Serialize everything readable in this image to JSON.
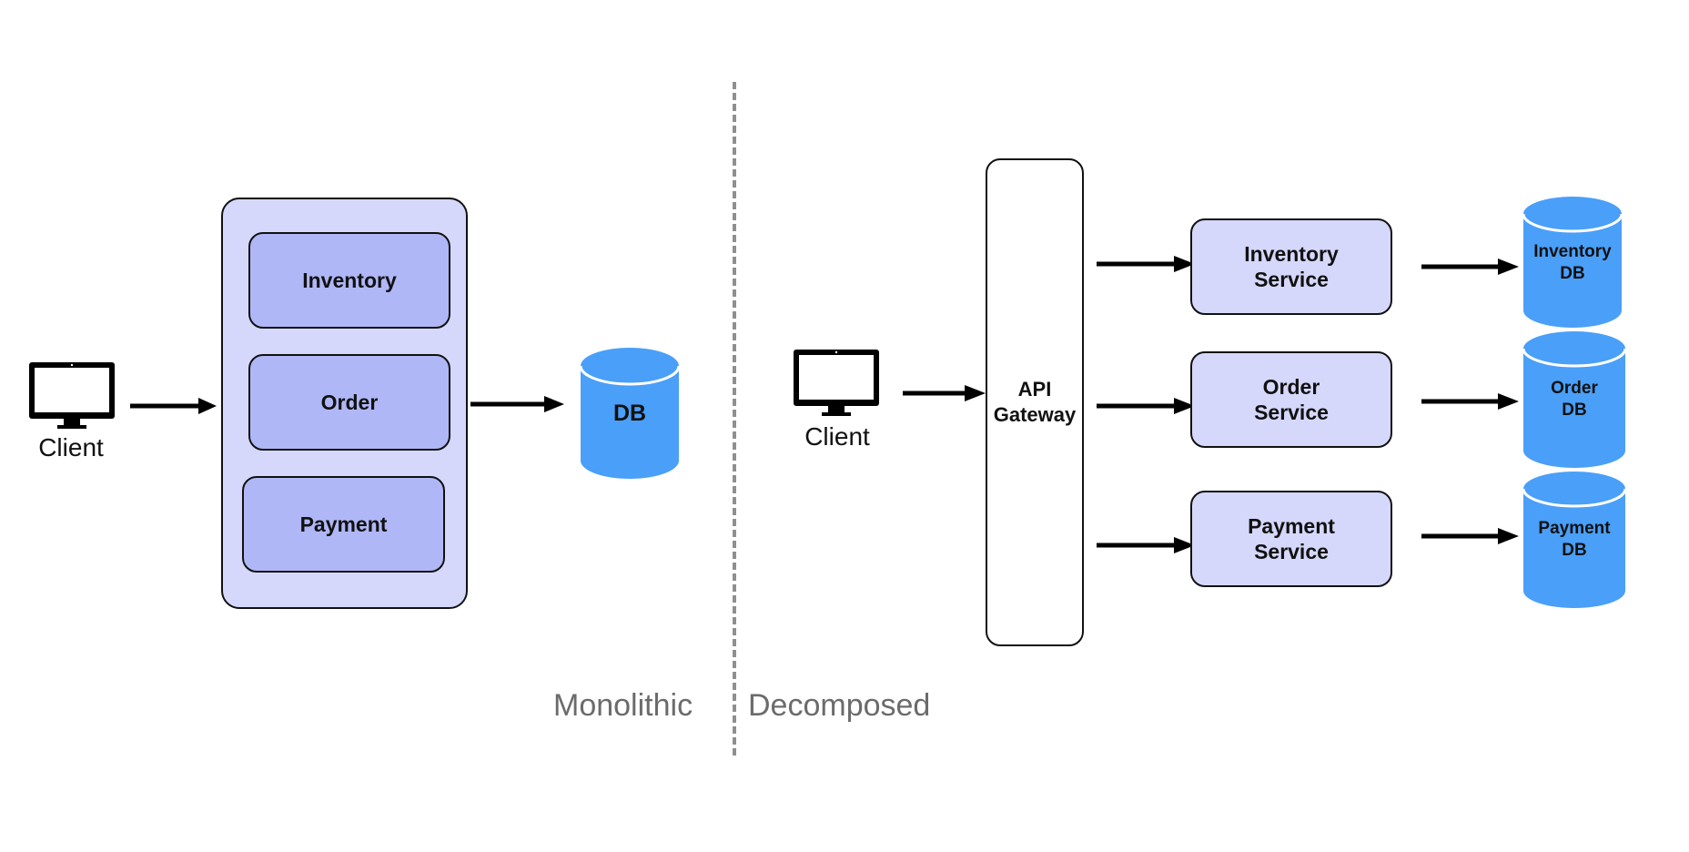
{
  "sections": {
    "monolithic": "Monolithic",
    "decomposed": "Decomposed"
  },
  "monolithic": {
    "client_label": "Client",
    "modules": [
      "Inventory",
      "Order",
      "Payment"
    ],
    "db_label": "DB"
  },
  "decomposed": {
    "client_label": "Client",
    "gateway_label": [
      "API",
      "Gateway"
    ],
    "services": [
      {
        "name": "Inventory",
        "suffix": "Service",
        "db": "Inventory",
        "db_suffix": "DB"
      },
      {
        "name": "Order",
        "suffix": "Service",
        "db": "Order",
        "db_suffix": "DB"
      },
      {
        "name": "Payment",
        "suffix": "Service",
        "db": "Payment",
        "db_suffix": "DB"
      }
    ]
  },
  "colors": {
    "container_fill": "#d5d8fb",
    "module_fill": "#b0b7f6",
    "db_fill": "#4a9ff8",
    "divider": "#8f8f8f",
    "section_label": "#6b6b6b"
  }
}
